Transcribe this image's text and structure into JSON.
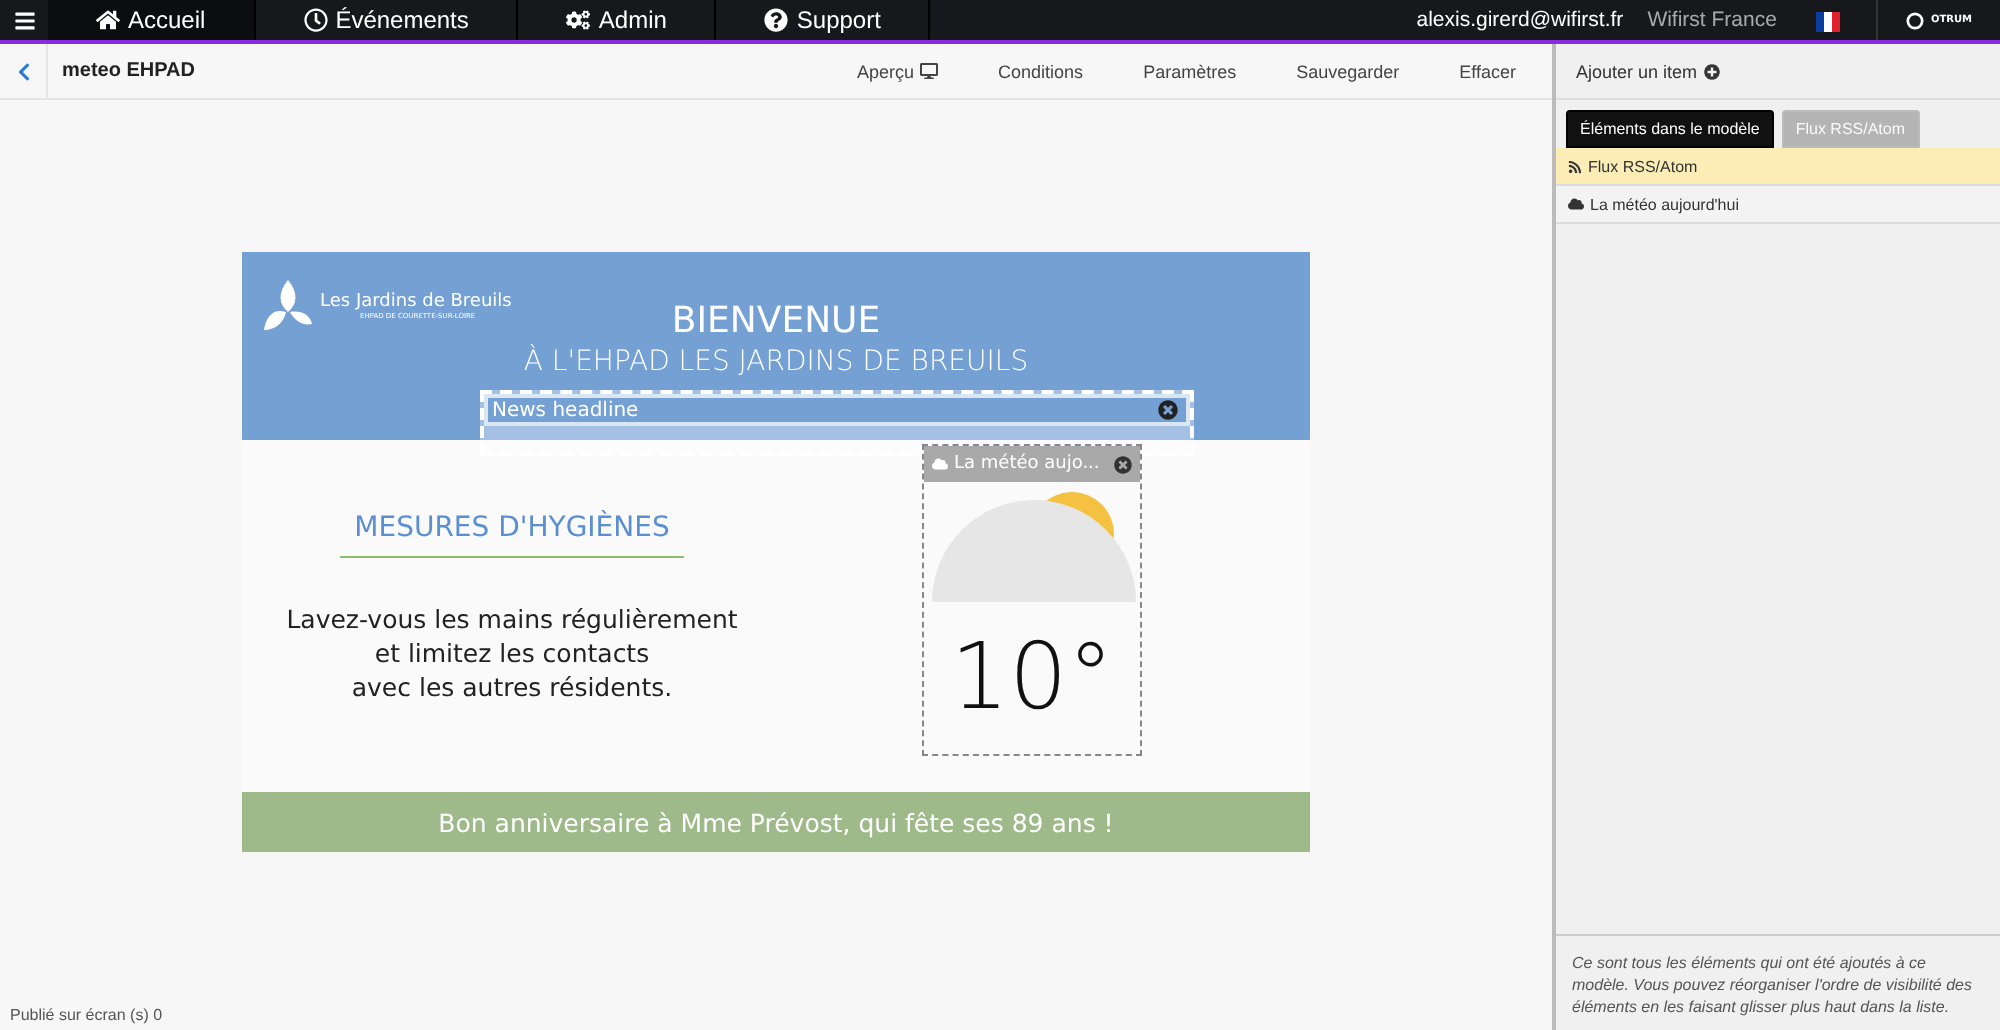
{
  "nav": {
    "tabs": [
      {
        "label": "Accueil",
        "selected": true
      },
      {
        "label": "Événements",
        "selected": false
      },
      {
        "label": "Admin",
        "selected": false
      },
      {
        "label": "Support",
        "selected": false
      }
    ],
    "user": "alexis.girerd@wifirst.fr",
    "org": "Wifirst France",
    "logo": "OTRUM"
  },
  "toolbar": {
    "title": "meteo EHPAD",
    "actions": [
      {
        "label": "Aperçu"
      },
      {
        "label": "Conditions"
      },
      {
        "label": "Paramètres"
      },
      {
        "label": "Sauvegarder"
      },
      {
        "label": "Effacer"
      }
    ]
  },
  "slide": {
    "brand": "Les Jardins de Breuils",
    "brand_sub": "EHPAD DE COURETTE-SUR-LOIRE",
    "title": "BIENVENUE",
    "subtitle": "À L'EHPAD LES JARDINS DE BREUILS",
    "news": "News headline",
    "heading": "MESURES D'HYGIÈNES",
    "body": [
      "Lavez-vous les mains régulièrement",
      "et limitez les contacts",
      "avec les autres résidents."
    ],
    "weather_title": "La météo aujo...",
    "temperature": "10°",
    "footer": "Bon anniversaire à Mme Prévost, qui fête ses 89 ans !"
  },
  "status": "Publié sur écran (s) 0",
  "panel": {
    "add_item": "Ajouter un item",
    "tabs": [
      {
        "label": "Éléments dans le modèle",
        "selected": true
      },
      {
        "label": "Flux RSS/Atom",
        "selected": false
      }
    ],
    "items": [
      {
        "label": "Flux RSS/Atom",
        "kind": "rss",
        "selected": true
      },
      {
        "label": "La météo aujourd'hui",
        "kind": "weather",
        "selected": false
      }
    ],
    "help": "Ce sont tous les éléments qui ont été ajoutés à ce modèle. Vous pouvez réorganiser l'ordre de visibilité des éléments en les faisant glisser plus haut dans la liste."
  }
}
